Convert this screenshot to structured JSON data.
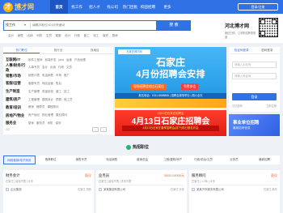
{
  "brand": {
    "logo_text": "博才网",
    "logo_sub": "hbrc.com",
    "accent": "#2f72e6"
  },
  "nav": {
    "items": [
      "首页",
      "找工作",
      "招人才",
      "找公司",
      "热门团批",
      "校园招聘"
    ],
    "more": "更多",
    "login_button": "登录/注册"
  },
  "search": {
    "type": "找工作",
    "placeholder": "请输入职位/公司/关键词",
    "button": "搜 索",
    "hotwords": [
      "会计",
      "销售",
      "出纳",
      "司机",
      "文员",
      "客服",
      "设计",
      "行政",
      "普工",
      "电工",
      "保安",
      "厨师"
    ]
  },
  "official": {
    "name": "河北博才网",
    "tip": "微信扫码，立求职招聘更便捷"
  },
  "categories": {
    "tabs": [
      "热门职位",
      "找行业",
      "找地区"
    ],
    "rows": [
      {
        "title": "互联网/IT",
        "items": [
          "软件工程师",
          "前端开发",
          "java",
          "运维",
          "产品经理"
        ]
      },
      {
        "title": "人事/财务/行政",
        "items": [
          "人事专员",
          "会计",
          "出纳",
          "行政",
          "文员"
        ]
      },
      {
        "title": "销售/市场",
        "items": [
          "销售代表",
          "电话销售",
          "市场",
          "推广"
        ]
      },
      {
        "title": "客服/运营",
        "items": [
          "客服专员",
          "网店运营",
          "售后"
        ]
      },
      {
        "title": "生产制造",
        "items": [
          "生产管理",
          "质量检验",
          "普工",
          "技工"
        ]
      },
      {
        "title": "建筑/房产",
        "items": [
          "工程管理",
          "建筑设计",
          "预算",
          "施工员"
        ]
      },
      {
        "title": "教育/培训",
        "items": [
          "教师",
          "辅导员",
          "课程顾问"
        ]
      },
      {
        "title": "房地产/物业",
        "items": [
          "房产经纪",
          "物业管理",
          "置业顾问"
        ]
      },
      {
        "title": "服务业",
        "items": [
          "厨师",
          "服务员",
          "司机",
          "保安"
        ]
      }
    ],
    "pager": "1/2"
  },
  "banner1": {
    "badge": "石家庄博才网",
    "top": "石家庄",
    "main": "4月份招聘会安排",
    "tag": "现场招聘会地点石家庄",
    "tag2": "免费参会",
    "strip": "报名电话：0311-8888888 | 招聘会现场举办 | 周六全天"
  },
  "banner2": {
    "title": "4月13日石家庄招聘会",
    "main": "4月13日石家庄招聘会",
    "strip": "4月13日石家庄春季招聘会(线下)现已报名开启"
  },
  "login": {
    "tabs": [
      "验证码登录",
      "密码登录"
    ],
    "phone_placeholder": "请输入手机号",
    "code_placeholder": "请输入验证码",
    "button": "登录",
    "links": [
      "忘记密码",
      "立即注册"
    ]
  },
  "reg_ad": {
    "title": "事业单位招聘",
    "sub": "最新招考信息"
  },
  "hot": {
    "title": "热招职位",
    "tabs": [
      "网络营销/电子商务",
      "推荐职位",
      "销售专员",
      "电话销售",
      "营销总监",
      "工程/建筑/房产",
      "行政/前台/文员",
      "业务员",
      "最新招聘"
    ],
    "jobs": [
      {
        "name": "财务会计",
        "salary": "面议",
        "tags": "石家庄 | 经验不限 | 大专",
        "company": "企业集团",
        "place": "石家庄-桥西"
      },
      {
        "name": "业务员",
        "salary": "3000-10000元",
        "tags": "石家庄 | 经验不限 | 学历不限",
        "company": "某某集团有限公司",
        "place": "石家庄-长安"
      },
      {
        "name": "服务顾问",
        "salary": "面议",
        "tags": "石家庄 | 1-3年 | 大专",
        "company": "某某汽车服务有限公司",
        "place": "石家庄-新华"
      }
    ]
  }
}
